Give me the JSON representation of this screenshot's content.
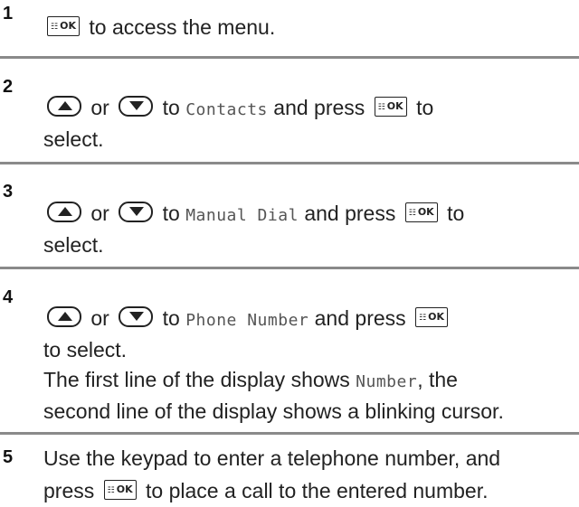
{
  "icons": {
    "ok_key": "menu-ok-key-icon",
    "up_key": "up-arrow-key-icon",
    "down_key": "down-arrow-key-icon"
  },
  "ok_key_label": "OK",
  "steps": [
    {
      "number": "1",
      "t1": "to access the menu."
    },
    {
      "number": "2",
      "or": "or",
      "t1": "to",
      "lcd": "Contacts",
      "t2": "and press",
      "t3": "to",
      "t4": "select."
    },
    {
      "number": "3",
      "or": "or",
      "t1": "to",
      "lcd": "Manual Dial",
      "t2": "and press",
      "t3": "to",
      "t4": "select."
    },
    {
      "number": "4",
      "or": "or",
      "t1": "to",
      "lcd": "Phone Number",
      "t2": "and press",
      "t3": "to select.",
      "t4": "The first line of the display shows",
      "lcd2": "Number",
      "t5": ", the",
      "t6": "second line of the display shows a blinking cursor."
    },
    {
      "number": "5",
      "t1": "Use the keypad to enter a telephone number, and",
      "t2": "press",
      "t3": "to place a call to the entered number."
    }
  ]
}
